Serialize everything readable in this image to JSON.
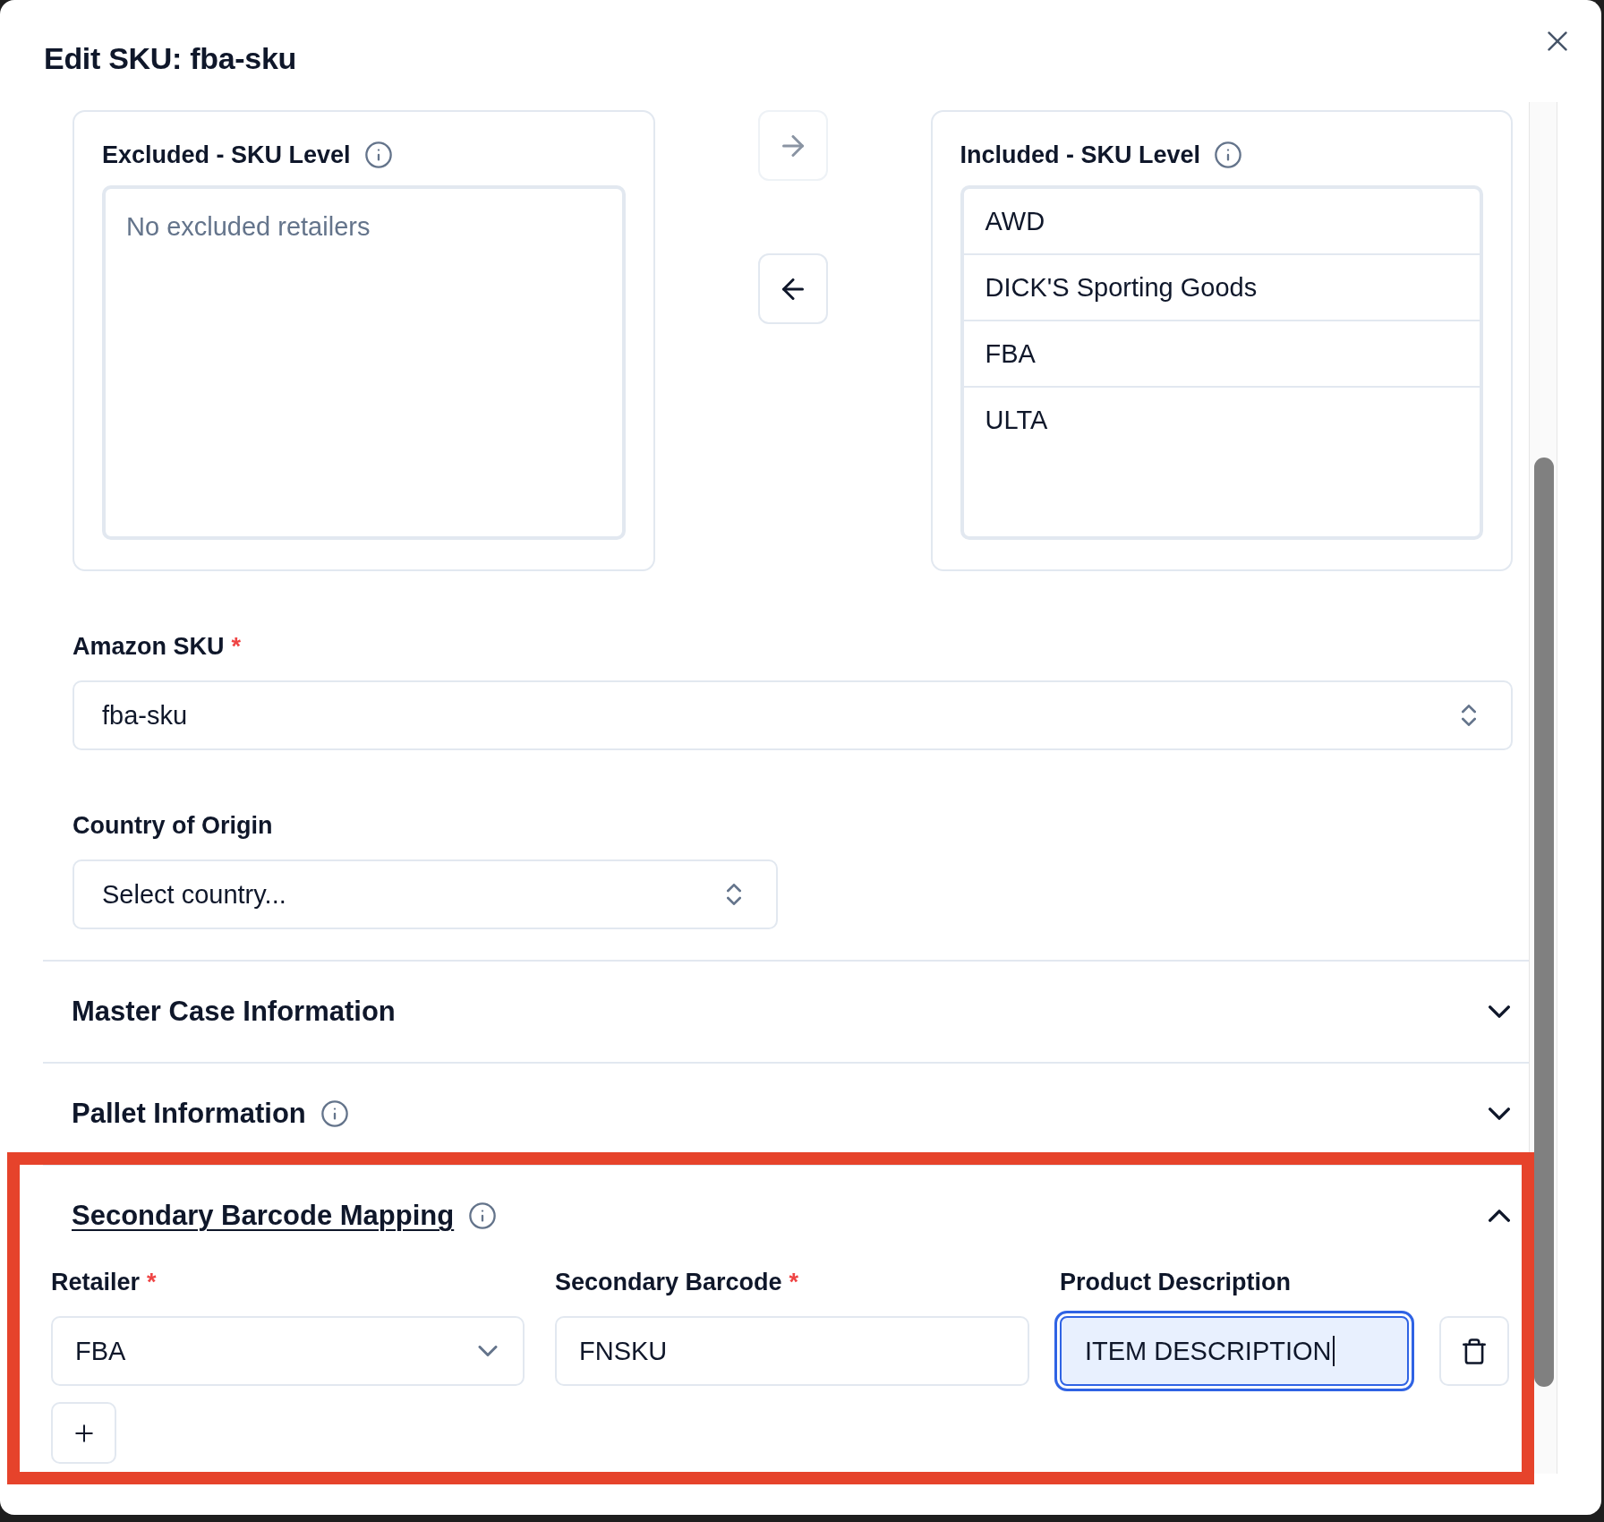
{
  "dialog": {
    "title": "Edit SKU: fba-sku"
  },
  "transfer": {
    "excluded": {
      "title": "Excluded - SKU Level",
      "info_icon": true,
      "empty_text": "No excluded retailers"
    },
    "buttons": [
      {
        "kind": "move-right",
        "disabled": true
      },
      {
        "kind": "move-left",
        "disabled": false
      }
    ],
    "included": {
      "title": "Included - SKU Level",
      "info_icon": true,
      "items": [
        {
          "label": "AWD",
          "selected": false
        },
        {
          "label": "DICK'S Sporting Goods",
          "selected": false
        },
        {
          "label": "FBA",
          "selected": false
        },
        {
          "label": "ULTA",
          "selected": false
        }
      ]
    }
  },
  "fields": [
    {
      "label": "Amazon SKU",
      "required_mark": "*",
      "value": "fba-sku"
    },
    {
      "label": "Country of Origin",
      "placeholder": "Select country..."
    }
  ],
  "sections": [
    {
      "title": "Master Case Information",
      "info_icon": false,
      "expanded": false,
      "hovered": false,
      "highlighted": false
    },
    {
      "title": "Pallet Information",
      "info_icon": true,
      "expanded": false,
      "hovered": false,
      "highlighted": false
    },
    {
      "title": "Secondary Barcode Mapping",
      "info_icon": true,
      "expanded": true,
      "hovered": true,
      "highlighted": true,
      "columns": [
        {
          "label": "Retailer",
          "required_mark": "*"
        },
        {
          "label": "Secondary Barcode",
          "required_mark": "*"
        },
        {
          "label": "Product Description"
        }
      ],
      "rows": [
        {
          "cells": [
            {
              "kind": "select",
              "value": "FBA",
              "focused": false
            },
            {
              "kind": "input",
              "value": "FNSKU",
              "focused": false
            },
            {
              "kind": "input",
              "value": "ITEM DESCRIPTION",
              "focused": true
            }
          ]
        }
      ]
    }
  ]
}
